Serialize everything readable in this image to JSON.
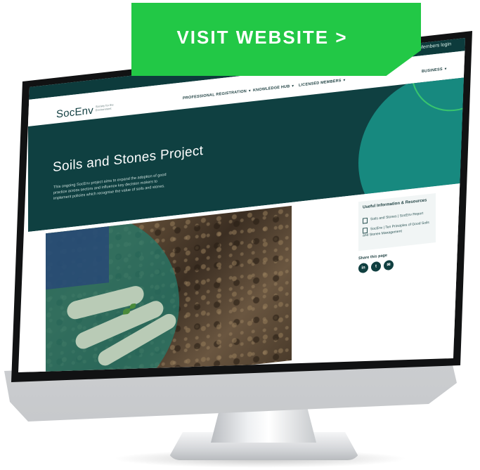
{
  "cta": {
    "label": "VISIT WEBSITE >"
  },
  "site": {
    "utility": {
      "member_login": "Members login"
    },
    "logo": {
      "name": "SocEnv",
      "tagline": "Society for the Environment"
    },
    "nav": [
      {
        "label": "PROFESSIONAL REGISTRATION"
      },
      {
        "label": "KNOWLEDGE HUB"
      },
      {
        "label": "LICENSED MEMBERS"
      },
      {
        "label": "BUSINESS"
      }
    ],
    "hero": {
      "title": "Soils and Stones Project",
      "description": "This ongoing SocEnv project aims to expand the adoption of good practice across sectors and influence key decision makers to implement policies which recognise the value of soils and stones."
    },
    "sidebar": {
      "heading": "Useful Information & Resources",
      "links": [
        {
          "label": "Soils and Stones | SocEnv Report"
        },
        {
          "label": "SocEnv | Ten Principles of Good Soils and Stones Management"
        }
      ]
    },
    "share": {
      "label": "Share this page",
      "buttons": [
        {
          "icon": "linkedin-icon",
          "glyph": "in"
        },
        {
          "icon": "twitter-icon",
          "glyph": "t"
        },
        {
          "icon": "email-icon",
          "glyph": "✉"
        }
      ]
    }
  },
  "colors": {
    "cta_green": "#22c846",
    "hero_dark_teal": "#0f4041",
    "hero_teal": "#17897f",
    "ring_green": "#38c56e"
  }
}
